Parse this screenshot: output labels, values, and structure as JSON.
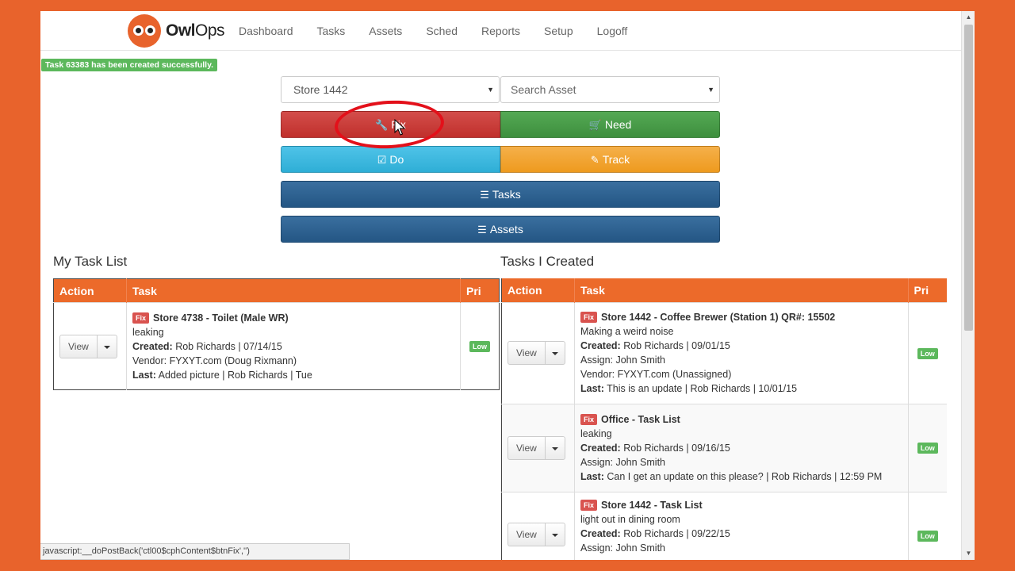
{
  "brand": {
    "name_bold": "Owl",
    "name_rest": "Ops"
  },
  "nav": [
    "Dashboard",
    "Tasks",
    "Assets",
    "Sched",
    "Reports",
    "Setup",
    "Logoff"
  ],
  "alert": "Task 63383 has been created successfully.",
  "store_select": {
    "value": "Store 1442"
  },
  "asset_select": {
    "value": "Search Asset"
  },
  "buttons": {
    "fix": "Fix",
    "need": "Need",
    "do": "Do",
    "track": "Track",
    "tasks": "Tasks",
    "assets": "Assets"
  },
  "my_task_list": {
    "title": "My Task List",
    "headers": {
      "action": "Action",
      "task": "Task",
      "pri": "Pri"
    },
    "rows": [
      {
        "view": "View",
        "badge": "Fix",
        "title": "Store 4738 - Toilet (Male WR)",
        "desc": "leaking",
        "created_label": "Created:",
        "created": "Rob Richards | 07/14/15",
        "vendor": "Vendor: FYXYT.com (Doug Rixmann)",
        "last_label": "Last:",
        "last": "Added picture | Rob Richards | Tue",
        "priority": "Low"
      }
    ]
  },
  "tasks_created": {
    "title": "Tasks I Created",
    "headers": {
      "action": "Action",
      "task": "Task",
      "pri": "Pri"
    },
    "rows": [
      {
        "view": "View",
        "badge": "Fix",
        "title": "Store 1442 - Coffee Brewer (Station 1) QR#: 15502",
        "desc": "Making a weird noise",
        "created_label": "Created:",
        "created": "Rob Richards | 09/01/15",
        "assign": "Assign: John Smith",
        "vendor": "Vendor: FYXYT.com (Unassigned)",
        "last_label": "Last:",
        "last": "This is an update | Rob Richards | 10/01/15",
        "priority": "Low"
      },
      {
        "view": "View",
        "badge": "Fix",
        "title": "Office - Task List",
        "desc": "leaking",
        "created_label": "Created:",
        "created": "Rob Richards | 09/16/15",
        "assign": "Assign: John Smith",
        "last_label": "Last:",
        "last": "Can I get an update on this please? | Rob Richards | 12:59 PM",
        "priority": "Low"
      },
      {
        "view": "View",
        "badge": "Fix",
        "title": "Store 1442 - Task List",
        "desc": "light out in dining room",
        "created_label": "Created:",
        "created": "Rob Richards | 09/22/15",
        "assign": "Assign: John Smith",
        "priority": "Low"
      }
    ]
  },
  "status_bar": "javascript:__doPostBack('ctl00$cphContent$btnFix','')",
  "colors": {
    "background": "#e8632c",
    "header": "#ec6a2a",
    "fix": "#c9302c",
    "need": "#449d44",
    "do": "#31b0d5",
    "track": "#ec971f",
    "primary": "#2d6494",
    "low": "#5cb85c"
  }
}
